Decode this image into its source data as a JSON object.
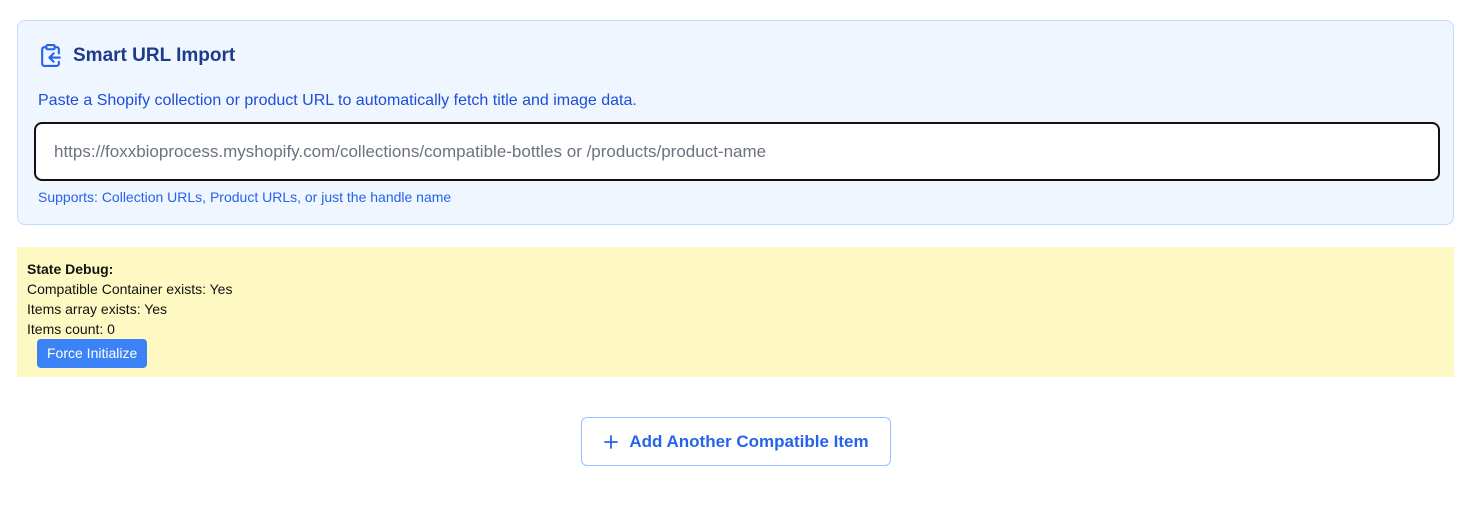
{
  "import_panel": {
    "title": "Smart URL Import",
    "title_icon": "clipboard-import-icon",
    "description": "Paste a Shopify collection or product URL to automatically fetch title and image data.",
    "url_input": {
      "value": "",
      "placeholder": "https://foxxbioprocess.myshopify.com/collections/compatible-bottles or /products/product-name"
    },
    "hint": "Supports: Collection URLs, Product URLs, or just the handle name"
  },
  "debug": {
    "title": "State Debug:",
    "lines": [
      "Compatible Container exists: Yes",
      "Items array exists: Yes",
      "Items count: 0"
    ],
    "button_label": "Force Initialize"
  },
  "add_button": {
    "label": "Add Another Compatible Item",
    "icon": "plus-icon"
  },
  "colors": {
    "panel_bg": "#eff6ff",
    "panel_border": "#bfdbfe",
    "title": "#1e3a8a",
    "link_blue": "#2563eb",
    "debug_bg": "#fef9c3",
    "debug_button": "#3b82f6"
  }
}
